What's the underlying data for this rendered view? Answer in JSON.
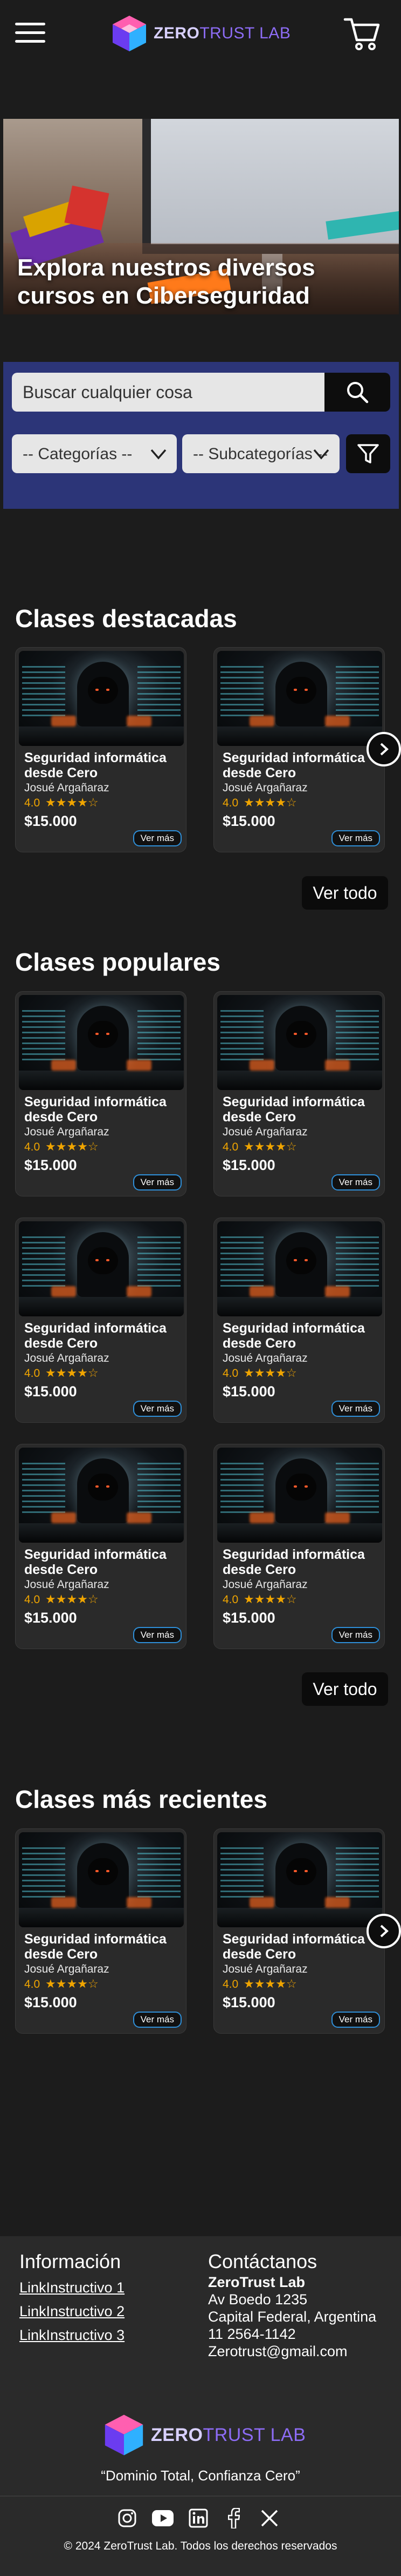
{
  "header": {
    "logo": {
      "part1": "ZERO",
      "part2": "TRUST LAB"
    },
    "menu_icon": "hamburger-icon",
    "cart_icon": "cart-icon"
  },
  "hero": {
    "title": "Explora nuestros diversos cursos en Ciberseguridad"
  },
  "search": {
    "placeholder": "Buscar cualquier cosa",
    "category": "-- Categorías --",
    "subcategory": "-- Subcategorías --"
  },
  "colors": {
    "panel": "#2c3578",
    "accent": "#2f8fd8",
    "rating": "#f0a500",
    "background": "#1c1c1c"
  },
  "sections": {
    "featured": {
      "title": "Clases destacadas",
      "see_all": "Ver todo",
      "cards": [
        {
          "title": "Seguridad informática desde Cero",
          "author": "Josué Argañaraz",
          "rating": "4.0",
          "stars": "★★★★☆",
          "price": "$15.000",
          "more": "Ver más"
        },
        {
          "title": "Seguridad informática desde Cero",
          "author": "Josué Argañaraz",
          "rating": "4.0",
          "stars": "★★★★☆",
          "price": "$15.000",
          "more": "Ver más"
        }
      ]
    },
    "popular": {
      "title": "Clases populares",
      "see_all": "Ver todo",
      "cards": [
        {
          "title": "Seguridad informática desde Cero",
          "author": "Josué Argañaraz",
          "rating": "4.0",
          "stars": "★★★★☆",
          "price": "$15.000",
          "more": "Ver más"
        },
        {
          "title": "Seguridad informática desde Cero",
          "author": "Josué Argañaraz",
          "rating": "4.0",
          "stars": "★★★★☆",
          "price": "$15.000",
          "more": "Ver más"
        },
        {
          "title": "Seguridad informática desde Cero",
          "author": "Josué Argañaraz",
          "rating": "4.0",
          "stars": "★★★★☆",
          "price": "$15.000",
          "more": "Ver más"
        },
        {
          "title": "Seguridad informática desde Cero",
          "author": "Josué Argañaraz",
          "rating": "4.0",
          "stars": "★★★★☆",
          "price": "$15.000",
          "more": "Ver más"
        },
        {
          "title": "Seguridad informática desde Cero",
          "author": "Josué Argañaraz",
          "rating": "4.0",
          "stars": "★★★★☆",
          "price": "$15.000",
          "more": "Ver más"
        },
        {
          "title": "Seguridad informática desde Cero",
          "author": "Josué Argañaraz",
          "rating": "4.0",
          "stars": "★★★★☆",
          "price": "$15.000",
          "more": "Ver más"
        }
      ]
    },
    "recent": {
      "title": "Clases más recientes",
      "cards": [
        {
          "title": "Seguridad informática desde Cero",
          "author": "Josué Argañaraz",
          "rating": "4.0",
          "stars": "★★★★☆",
          "price": "$15.000",
          "more": "Ver más"
        },
        {
          "title": "Seguridad informática desde Cero",
          "author": "Josué Argañaraz",
          "rating": "4.0",
          "stars": "★★★★☆",
          "price": "$15.000",
          "more": "Ver más"
        }
      ]
    }
  },
  "footer": {
    "info_title": "Información",
    "links": [
      "LinkInstructivo 1",
      "LinkInstructivo 2",
      "LinkInstructivo 3"
    ],
    "contact_title": "Contáctanos",
    "contact_lines": [
      "ZeroTrust Lab",
      "Av Boedo 1235",
      "Capital Federal, Argentina",
      "11 2564-1142",
      "Zerotrust@gmail.com"
    ],
    "logo": {
      "part1": "ZERO",
      "part2": "TRUST LAB"
    },
    "motto": "“Dominio Total, Confianza Cero”",
    "copyright": "© 2024 ZeroTrust Lab. Todos los derechos reservados",
    "social_icons": [
      "instagram-icon",
      "youtube-icon",
      "linkedin-icon",
      "facebook-icon",
      "x-icon"
    ]
  }
}
